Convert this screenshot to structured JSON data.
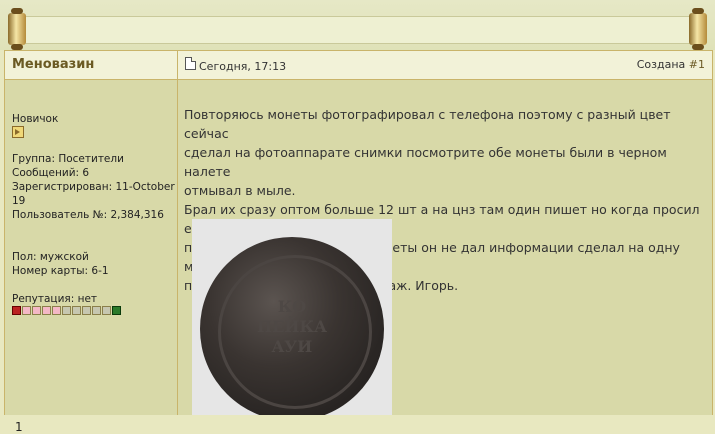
{
  "author": {
    "name": "Меновазин",
    "rank": "Новичок",
    "group": "Группа: Посетители",
    "messages": "Сообщений: 6",
    "registered": "Зарегистрирован: 11-October",
    "registered_year": "19",
    "user_no": "Пользователь №: 2,384,316",
    "gender": "Пол: мужской",
    "card": "Номер карты: 6-1",
    "reputation": "Репутация: нет"
  },
  "post": {
    "date": "Сегодня, 17:13",
    "created_label": "Создана",
    "number": "#1",
    "text": "Повторяюсь монеты фотографировал с телефона поэтому с разный цвет сейчас\nсделал на фотоаппарате снимки посмотрите обе монеты были в черном налете\nотмывал в мыле.\nБрал их сразу оптом больше 12 шт а на цнз там один пишет но когда просил его\nпоказать где он брал фото монеты он не дал информации сделал на одну монету\nпозже добавлю на вторую с уваж. Игорь.",
    "image_caption": "1",
    "coin_legend": "КО\nПЕЙКА\nAУИ"
  }
}
